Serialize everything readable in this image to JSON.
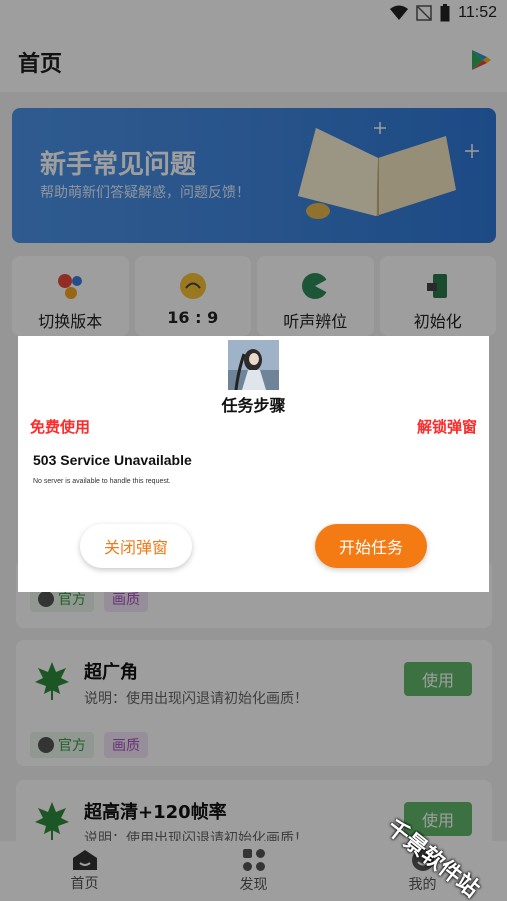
{
  "status_bar": {
    "time": "11:52"
  },
  "header": {
    "title": "首页"
  },
  "banner": {
    "title": "新手常见问题",
    "subtitle": "帮助萌新们答疑解惑，问题反馈！"
  },
  "quick_actions": [
    {
      "label": "切换版本",
      "icon": "version-switch-icon"
    },
    {
      "label": "16 : 9",
      "icon": "aspect-ratio-icon"
    },
    {
      "label": "听声辨位",
      "icon": "sound-position-icon"
    },
    {
      "label": "初始化",
      "icon": "initialize-icon"
    }
  ],
  "cards": [
    {
      "title": "超广角",
      "desc": "说明：使用出现闪退请初始化画质！",
      "button": "使用",
      "tags": [
        "官方",
        "画质"
      ]
    },
    {
      "title": "超高清+120帧率",
      "desc": "说明：使用出现闪退请初始化画质！",
      "button": "使用"
    }
  ],
  "partial_tags": [
    "官方",
    "画质"
  ],
  "nav": [
    {
      "label": "首页",
      "icon": "home-icon"
    },
    {
      "label": "发现",
      "icon": "discover-icon"
    },
    {
      "label": "我的",
      "icon": "profile-icon"
    }
  ],
  "dialog": {
    "title": "任务步骤",
    "free_use": "免费使用",
    "unlock_popup": "解锁弹窗",
    "error_title": "503 Service Unavailable",
    "error_body": "No server is available to handle this request.",
    "close_button": "关闭弹窗",
    "start_button": "开始任务"
  },
  "watermark": "千景软件站",
  "colors": {
    "accent": "#f47b14",
    "use_button": "#62b86a",
    "banner": "#3f86df",
    "warning_text": "#ff2a2a"
  }
}
